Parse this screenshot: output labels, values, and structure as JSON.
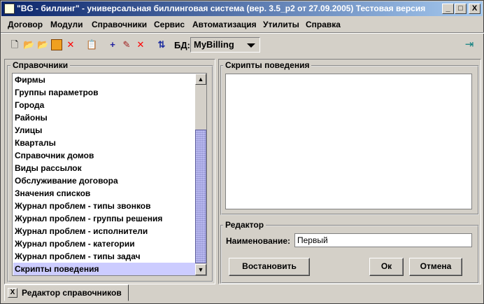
{
  "window": {
    "title": "\"BG - биллинг\" - универсальная биллинговая система (вер. 3.5_p2 от 27.09.2005) Тестовая версия",
    "minimize": "_",
    "maximize": "□",
    "close": "X"
  },
  "menu": [
    "Договор",
    "Модули",
    "Справочники",
    "Сервис",
    "Автоматизация",
    "Утилиты",
    "Справка"
  ],
  "toolbar": {
    "db_label": "БД:",
    "db_value": "MyBilling"
  },
  "left": {
    "title": "Справочники",
    "items": [
      "Фирмы",
      "Группы параметров",
      "Города",
      "Районы",
      "Улицы",
      "Кварталы",
      "Справочник домов",
      "Виды рассылок",
      "Обслуживание договора",
      "Значения списков",
      "Журнал проблем - типы звонков",
      "Журнал проблем - группы решения",
      "Журнал проблем - исполнители",
      "Журнал проблем - категории",
      "Журнал проблем - типы задач",
      "Скрипты поведения"
    ],
    "selected_index": 15
  },
  "scripts": {
    "title": "Скрипты поведения"
  },
  "editor": {
    "title": "Редактор",
    "name_label": "Наименование:",
    "name_value": "Первый",
    "restore": "Востановить",
    "ok": "Ок",
    "cancel": "Отмена"
  },
  "tab": {
    "close": "X",
    "label": "Редактор справочников"
  }
}
